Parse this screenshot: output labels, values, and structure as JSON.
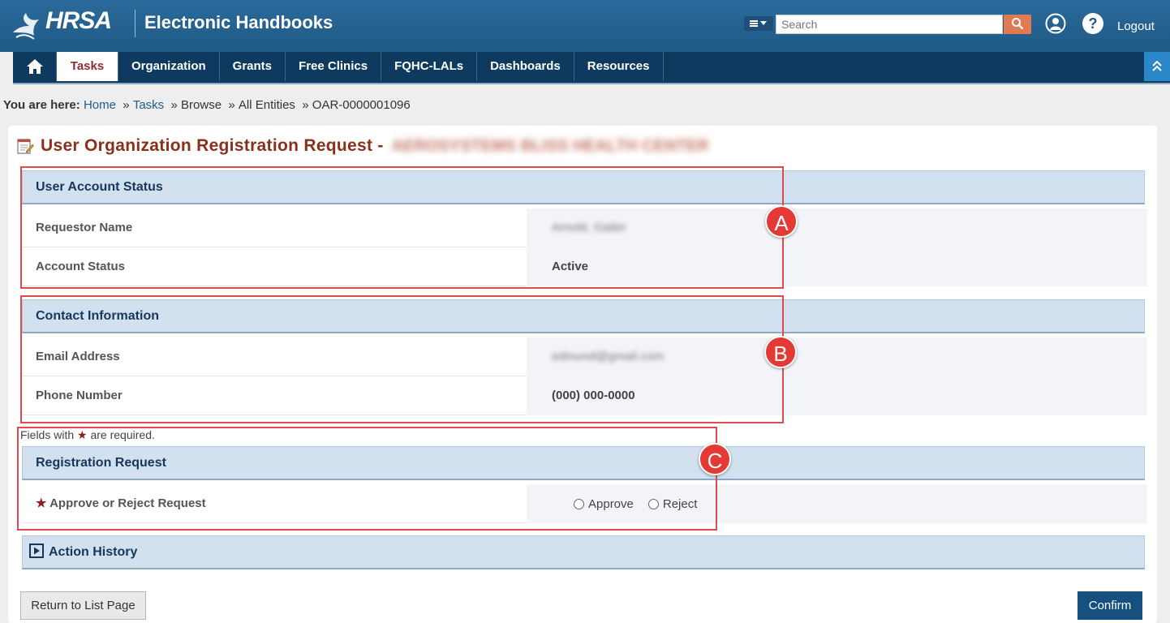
{
  "header": {
    "logo_text": "HRSA",
    "app_title": "Electronic Handbooks",
    "search_placeholder": "Search",
    "logout_label": "Logout"
  },
  "nav": {
    "items": [
      "Tasks",
      "Organization",
      "Grants",
      "Free Clinics",
      "FQHC-LALs",
      "Dashboards",
      "Resources"
    ],
    "active": "Tasks"
  },
  "breadcrumb": {
    "prefix": "You are here:",
    "items": [
      "Home",
      "Tasks",
      "Browse",
      "All Entities",
      "OAR-0000001096"
    ]
  },
  "page": {
    "title": "User Organization Registration Request -",
    "org_name": "AEROSYSTEMS BLISS HEALTH CENTER"
  },
  "user_account_status": {
    "header": "User Account Status",
    "requestor_name_label": "Requestor Name",
    "requestor_name_value": "Arnold, Gailer",
    "account_status_label": "Account Status",
    "account_status_value": "Active"
  },
  "contact_information": {
    "header": "Contact Information",
    "email_label": "Email Address",
    "email_value": "edmund@gmail.com",
    "phone_label": "Phone Number",
    "phone_value": "(000) 000-0000"
  },
  "required_note": {
    "prefix": "Fields with",
    "suffix": "are required."
  },
  "registration_request": {
    "header": "Registration Request",
    "field_label": "Approve or Reject Request",
    "options": [
      "Approve",
      "Reject"
    ]
  },
  "action_history": {
    "header": "Action History"
  },
  "buttons": {
    "return": "Return to List Page",
    "confirm": "Confirm"
  },
  "annotations": [
    "A",
    "B",
    "C"
  ],
  "colors": {
    "header_bg": "#205a86",
    "nav_bg": "#0e3a5f",
    "title": "#8a2f1a",
    "section_header_bg": "#d1e1ef",
    "annotation": "#e53935",
    "confirm_bg": "#16507f"
  }
}
